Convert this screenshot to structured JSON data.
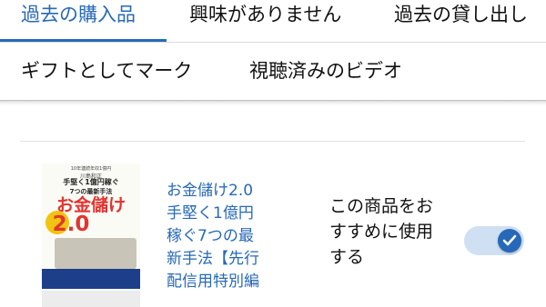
{
  "tabs": {
    "row1": [
      "過去の購入品",
      "興味がありません",
      "過去の貸し出し"
    ],
    "row2": [
      "ギフトとしてマーク",
      "視聴済みのビデオ"
    ],
    "active": "過去の購入品"
  },
  "item": {
    "cover": {
      "top_text": "10年連続年収1億円",
      "author": "川島和正",
      "subtitle_line1": "手堅く1億円稼ぐ",
      "subtitle_line2": "7つの最新手法",
      "title": "お金儲け",
      "number": "2.0"
    },
    "title_lines": [
      "お金儲け2.0",
      "手堅く1億円",
      "稼ぐ7つの最",
      "新手法【先行",
      "配信用特別編"
    ],
    "recommend_lines": [
      "この商品をお",
      "すすめに使用",
      "する"
    ],
    "recommend_toggle": "on",
    "colors": {
      "accent": "#2769b8",
      "toggle_track": "#cfe0f3"
    },
    "toggle_icon": "check-icon"
  }
}
